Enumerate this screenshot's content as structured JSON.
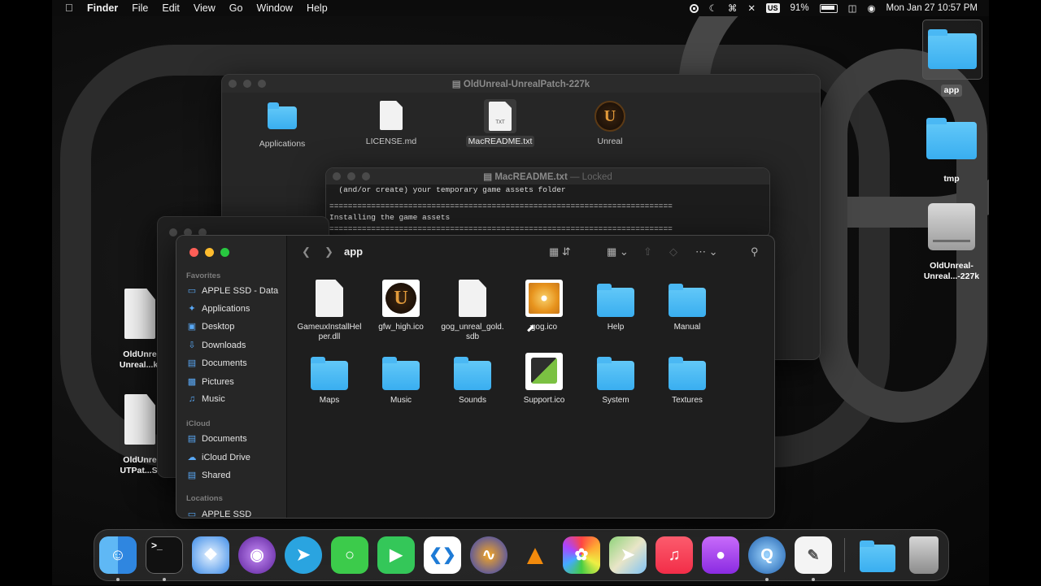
{
  "menubar": {
    "app": "Finder",
    "menus": [
      "File",
      "Edit",
      "View",
      "Go",
      "Window",
      "Help"
    ],
    "input_source": "US",
    "battery": "91%",
    "datetime": "Mon Jan 27  10:57 PM"
  },
  "desktop_icons": {
    "app": "app",
    "tmp": "tmp",
    "drive1_l1": "OldUnreal-",
    "drive1_l2": "Unreal...-227k",
    "left1_l1": "OldUnre",
    "left1_l2": "Unreal...k.",
    "left2_l1": "OldUnre",
    "left2_l2": "UTPat...S."
  },
  "dmg_window": {
    "title": "OldUnreal-UnrealPatch-227k",
    "items": [
      "Applications",
      "LICENSE.md",
      "MacREADME.txt",
      "Unreal"
    ],
    "txt_badge": "TXT"
  },
  "readme_window": {
    "title": "MacREADME.txt",
    "locked": "— Locked",
    "line1": "  (and/or create) your temporary game assets folder",
    "rule": "==========================================================================",
    "line2": "Installing the game assets"
  },
  "finder": {
    "title": "app",
    "sidebar": {
      "favorites": "Favorites",
      "fav_items": [
        "APPLE SSD - Data",
        "Applications",
        "Desktop",
        "Downloads",
        "Documents",
        "Pictures",
        "Music"
      ],
      "icloud": "iCloud",
      "icloud_items": [
        "Documents",
        "iCloud Drive",
        "Shared"
      ],
      "locations": "Locations",
      "loc_items": [
        "APPLE SSD"
      ]
    },
    "files": [
      {
        "name": "GameuxInstallHelper.dll",
        "l1": "GameuxInstallHel",
        "l2": "per.dll"
      },
      {
        "name": "gfw_high.ico",
        "l1": "gfw_high.ico",
        "l2": ""
      },
      {
        "name": "gog_unreal_gold.sdb",
        "l1": "gog_unreal_gold.",
        "l2": "sdb"
      },
      {
        "name": "gog.ico",
        "l1": "gog.ico",
        "l2": ""
      },
      {
        "name": "Help",
        "l1": "Help",
        "l2": ""
      },
      {
        "name": "Manual",
        "l1": "Manual",
        "l2": ""
      },
      {
        "name": "Maps",
        "l1": "Maps",
        "l2": ""
      },
      {
        "name": "Music",
        "l1": "Music",
        "l2": ""
      },
      {
        "name": "Sounds",
        "l1": "Sounds",
        "l2": ""
      },
      {
        "name": "Support.ico",
        "l1": "Support.ico",
        "l2": ""
      },
      {
        "name": "System",
        "l1": "System",
        "l2": ""
      },
      {
        "name": "Textures",
        "l1": "Textures",
        "l2": ""
      }
    ]
  },
  "dock": {
    "apps": [
      "Finder",
      "Terminal",
      "Safari",
      "Tor Browser",
      "Telegram",
      "Messages",
      "FaceTime",
      "Visual Studio Code",
      "Audacity",
      "VLC",
      "Photos",
      "Maps",
      "Music",
      "Podcasts",
      "QuickTime Player",
      "TextEdit",
      "Downloads",
      "Trash"
    ]
  }
}
